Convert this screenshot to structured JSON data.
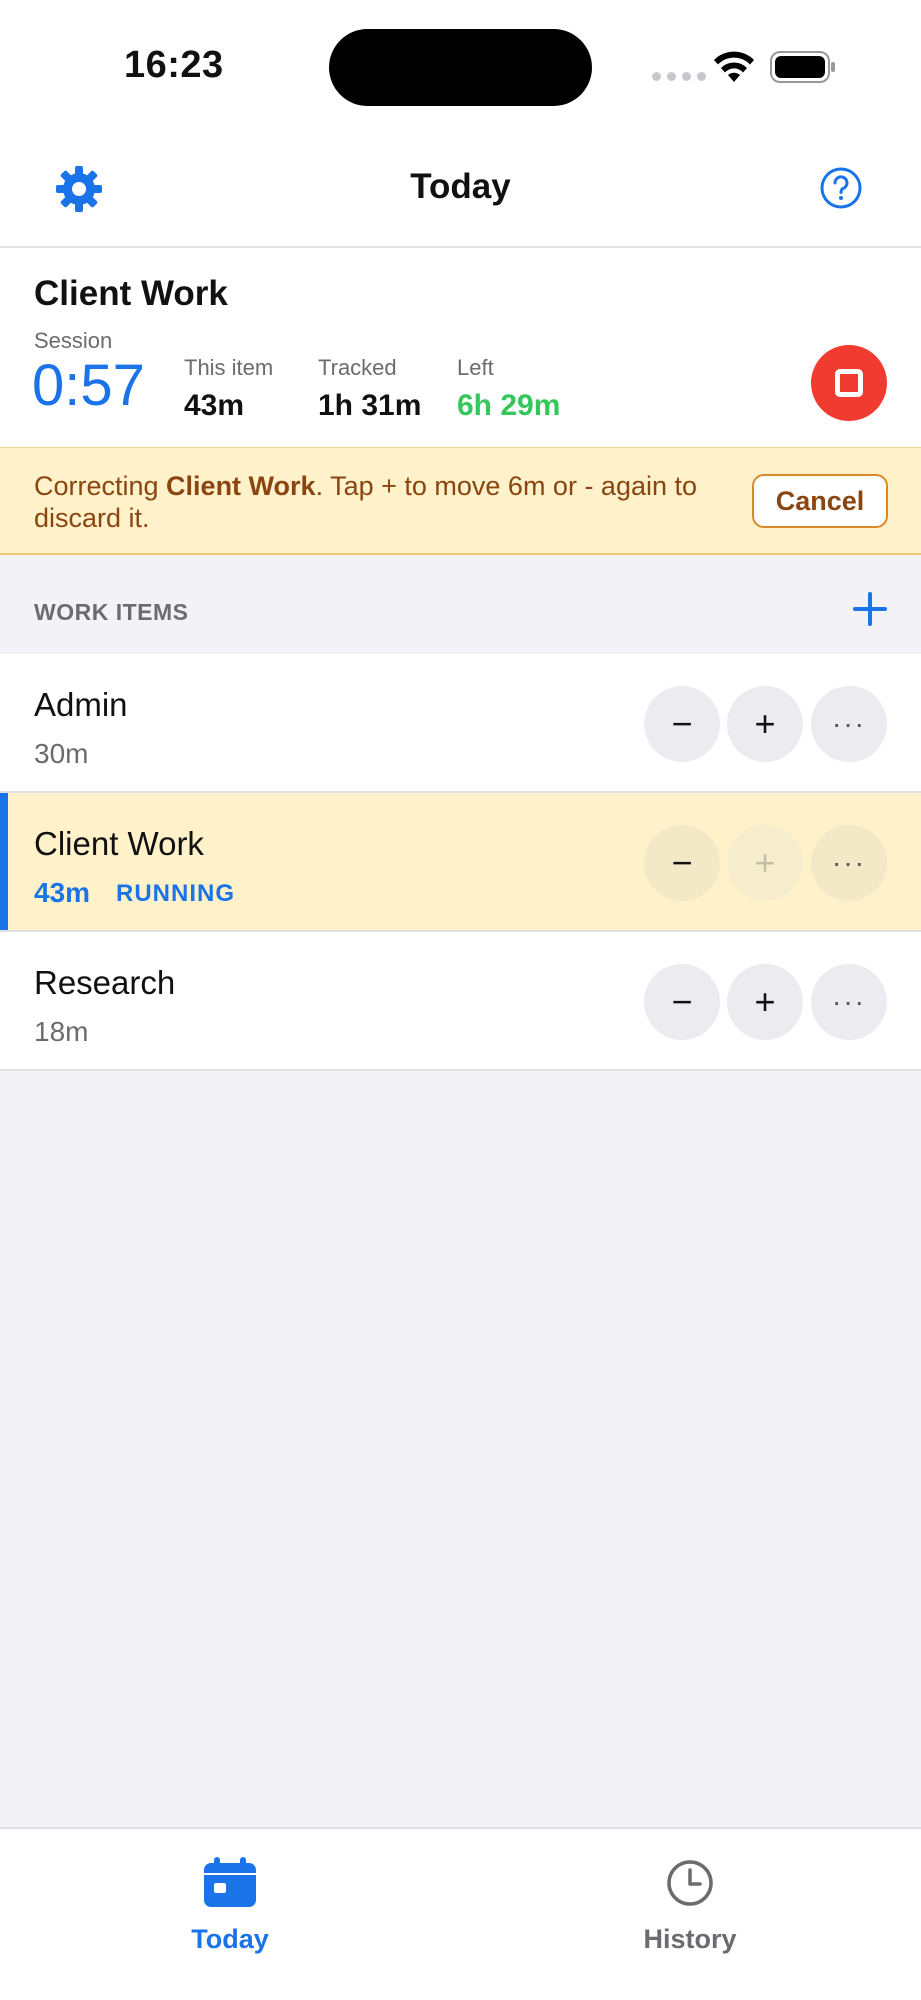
{
  "status_bar": {
    "time": "16:23"
  },
  "nav": {
    "title": "Today",
    "settings_icon": "gear-icon",
    "help_icon": "question-circle-icon"
  },
  "current": {
    "title": "Client Work",
    "session_label": "Session",
    "session_value": "0:57",
    "this_item_label": "This item",
    "this_item_value": "43m",
    "tracked_label": "Tracked",
    "tracked_value": "1h 31m",
    "left_label": "Left",
    "left_value": "6h 29m"
  },
  "banner": {
    "prefix": "Correcting ",
    "item": "Client Work",
    "suffix": ". Tap + to move 6m or - again to discard it.",
    "cancel_label": "Cancel"
  },
  "section": {
    "label": "WORK ITEMS"
  },
  "items": [
    {
      "name": "Admin",
      "duration": "30m"
    },
    {
      "name": "Client Work",
      "duration": "43m",
      "badge": "RUNNING"
    },
    {
      "name": "Research",
      "duration": "18m"
    }
  ],
  "controls": {
    "minus": "−",
    "plus": "+",
    "more": "···"
  },
  "tabs": [
    {
      "label": "Today",
      "icon": "calendar-icon"
    },
    {
      "label": "History",
      "icon": "clock-icon"
    }
  ],
  "colors": {
    "accent": "#1a73e8",
    "stop": "#f23b30",
    "left": "#34c759",
    "banner_bg": "#fff1ca"
  }
}
